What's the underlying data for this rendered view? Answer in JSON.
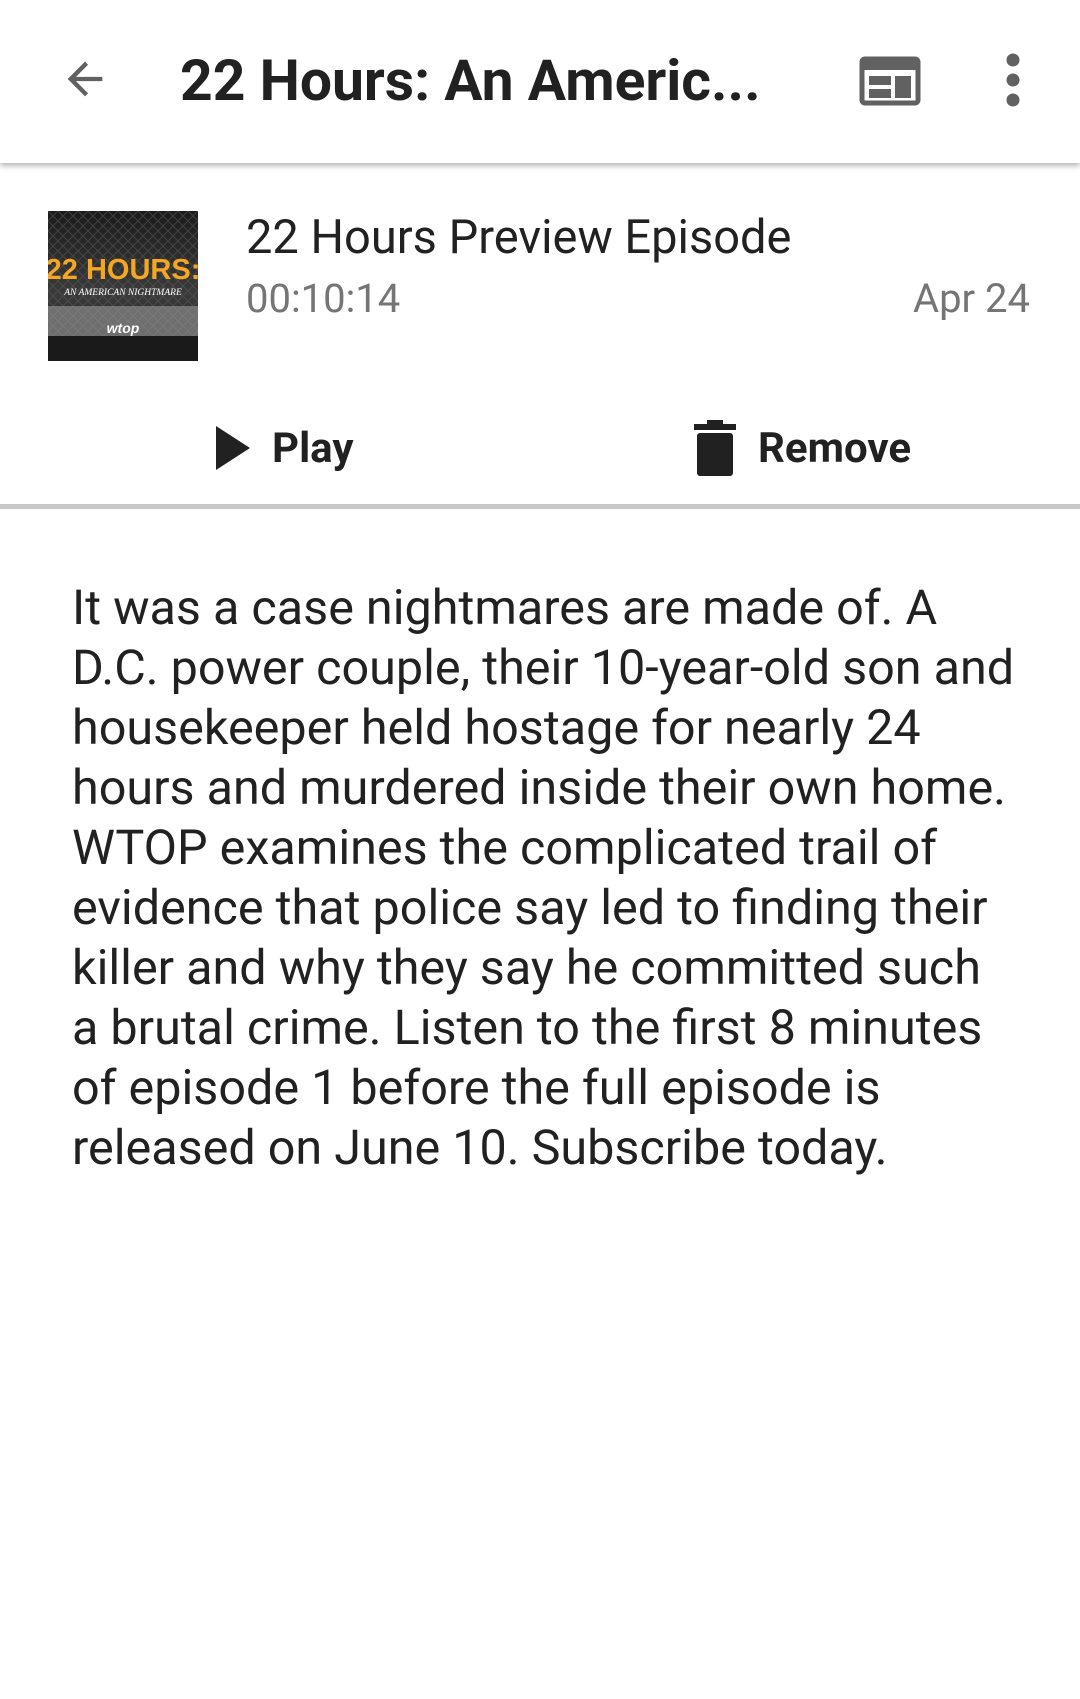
{
  "app_bar": {
    "title": "22 Hours: An Americ...",
    "back_icon": "arrow-left-icon",
    "web_icon": "web-browser-icon",
    "more_icon": "more-vertical-icon"
  },
  "episode": {
    "cover": {
      "title_text": "22 HOURS:",
      "subtitle_text": "AN AMERICAN NIGHTMARE",
      "brand_text": "wtop",
      "accent_color": "#f5a623"
    },
    "title": "22 Hours Preview Episode",
    "duration": "00:10:14",
    "date": "Apr 24",
    "actions": {
      "play_label": "Play",
      "play_icon": "play-icon",
      "remove_label": "Remove",
      "remove_icon": "trash-icon"
    },
    "description": "It was a case nightmares are made of. A D.C. power couple, their 10-year-old son and housekeeper held hostage for nearly 24 hours and murdered inside their own home. WTOP examines the complicated trail of evidence that police say led to finding their killer and why they say he committed such a brutal crime. Listen to the first 8 minutes of episode 1 before the full episode is released on June 10. Subscribe today."
  }
}
